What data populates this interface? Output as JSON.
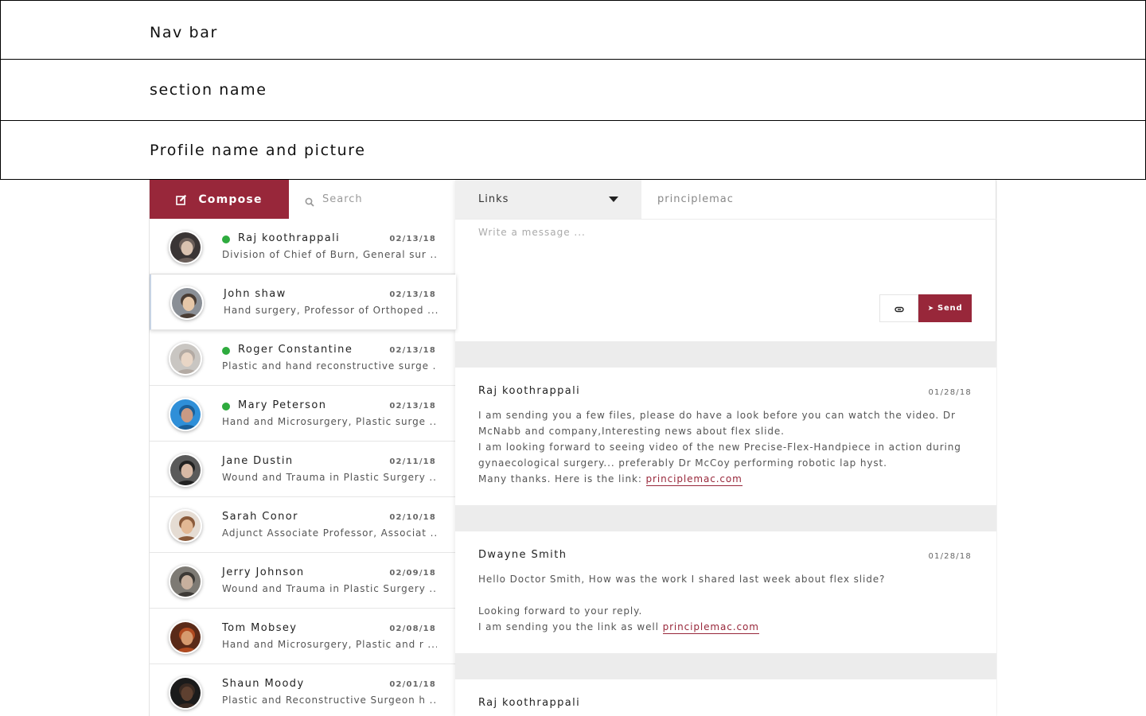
{
  "nav": {
    "label": "Nav bar"
  },
  "section": {
    "label": "section name"
  },
  "profile": {
    "label": "Profile name and picture"
  },
  "colors": {
    "accent": "#98273a",
    "online": "#2eab3e",
    "separator": "#ececec"
  },
  "compose": {
    "label": "Compose",
    "icon": "edit-icon"
  },
  "search": {
    "placeholder": "Search",
    "icon": "search-icon"
  },
  "conversations": [
    {
      "name": "Raj koothrappali",
      "date": "02/13/18",
      "desc": "Division of Chief of Burn, General sur ...",
      "online": true
    },
    {
      "name": "John shaw",
      "date": "02/13/18",
      "desc": "Hand surgery, Professor of Orthoped  ...",
      "online": false,
      "active": true
    },
    {
      "name": "Roger Constantine",
      "date": "02/13/18",
      "desc": "Plastic and hand reconstructive surge ...",
      "online": true
    },
    {
      "name": "Mary Peterson",
      "date": "02/13/18",
      "desc": "Hand and Microsurgery, Plastic surge ...",
      "online": true
    },
    {
      "name": "Jane Dustin",
      "date": "02/11/18",
      "desc": "Wound and Trauma in Plastic Surgery ...",
      "online": false
    },
    {
      "name": "Sarah Conor",
      "date": "02/10/18",
      "desc": "Adjunct Associate Professor, Associat ...",
      "online": false
    },
    {
      "name": "Jerry Johnson",
      "date": "02/09/18",
      "desc": "Wound and Trauma in Plastic Surgery ...",
      "online": false
    },
    {
      "name": "Tom Mobsey",
      "date": "02/08/18",
      "desc": "Hand and Microsurgery, Plastic and r ...",
      "online": false
    },
    {
      "name": "Shaun Moody",
      "date": "02/01/18",
      "desc": "Plastic and Reconstructive Surgeon h ...",
      "online": false
    }
  ],
  "composer": {
    "links_label": "Links",
    "to_value": "principlemac",
    "message_placeholder": "Write a message ...",
    "attach_icon": "paperclip-icon",
    "send_label": "Send",
    "send_icon": "paper-plane-icon"
  },
  "messages": [
    {
      "author": "Raj koothrappali",
      "date": "01/28/18",
      "lines": [
        "I am sending you a few files, please do have a look before you can watch the video. Dr McNabb and company,Interesting news about flex slide.",
        "I am looking forward to seeing video of the new Precise-Flex-Handpiece in action during gynaecological surgery... preferably Dr McCoy performing robotic lap hyst."
      ],
      "link_prefix": "Many thanks. Here is the link: ",
      "link_text": "principlemac.com"
    },
    {
      "author": "Dwayne Smith",
      "date": "01/28/18",
      "lines": [
        "Hello Doctor Smith, How was the work I shared last week about flex slide?",
        "",
        "Looking forward to your reply."
      ],
      "link_prefix": "I am sending you the link as well ",
      "link_text": "principlemac.com"
    },
    {
      "author": "Raj koothrappali"
    }
  ]
}
